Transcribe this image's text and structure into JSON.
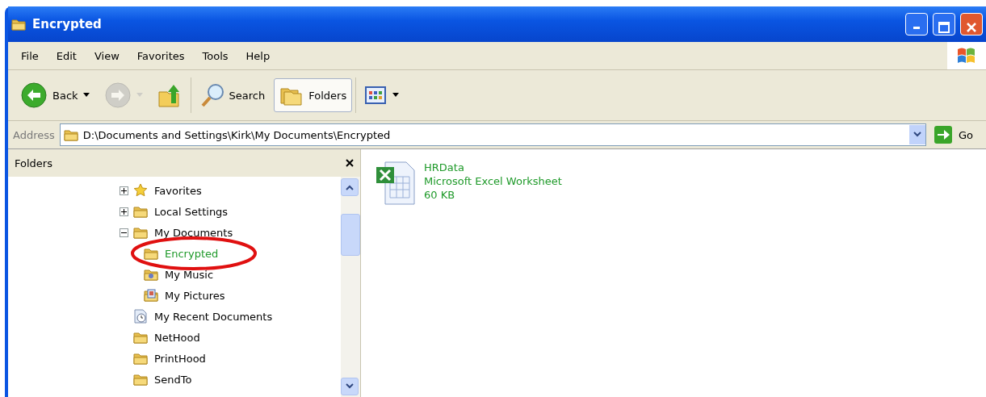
{
  "window": {
    "title": "Encrypted"
  },
  "menu": [
    {
      "label": "File"
    },
    {
      "label": "Edit"
    },
    {
      "label": "View"
    },
    {
      "label": "Favorites"
    },
    {
      "label": "Tools"
    },
    {
      "label": "Help"
    }
  ],
  "toolbar": [
    {
      "kind": "back",
      "label": "Back",
      "disabled": false,
      "selected": false
    },
    {
      "kind": "forward",
      "disabled": true,
      "selected": false
    },
    {
      "kind": "up",
      "disabled": false,
      "selected": false
    },
    {
      "kind": "search",
      "label": "Search",
      "disabled": false,
      "selected": false
    },
    {
      "kind": "folders",
      "label": "Folders",
      "disabled": false,
      "selected": true
    },
    {
      "kind": "views",
      "disabled": false,
      "selected": false
    }
  ],
  "address": {
    "label": "Address",
    "value": "D:\\Documents and Settings\\Kirk\\My Documents\\Encrypted",
    "go": "Go"
  },
  "folders_pane": {
    "title": "Folders"
  },
  "tree": [
    {
      "name": "Favorites",
      "kind": "star",
      "expanded": false,
      "encrypted": false
    },
    {
      "name": "Local Settings",
      "kind": "folder",
      "expanded": false,
      "encrypted": false
    },
    {
      "name": "My Documents",
      "kind": "folder",
      "expanded": true,
      "encrypted": false,
      "children": [
        {
          "name": "Encrypted",
          "kind": "folder",
          "encrypted": true,
          "circled": true
        },
        {
          "name": "My Music",
          "kind": "music",
          "encrypted": false,
          "circled": false
        },
        {
          "name": "My Pictures",
          "kind": "pictures",
          "encrypted": false,
          "circled": false
        }
      ]
    },
    {
      "name": "My Recent Documents",
      "kind": "recent",
      "encrypted": false
    },
    {
      "name": "NetHood",
      "kind": "folder",
      "encrypted": false
    },
    {
      "name": "PrintHood",
      "kind": "folder",
      "encrypted": false
    },
    {
      "name": "SendTo",
      "kind": "folder",
      "encrypted": false
    }
  ],
  "files": [
    {
      "name": "HRData",
      "type": "Microsoft Excel Worksheet",
      "size": "60 KB",
      "encrypted": true
    }
  ]
}
